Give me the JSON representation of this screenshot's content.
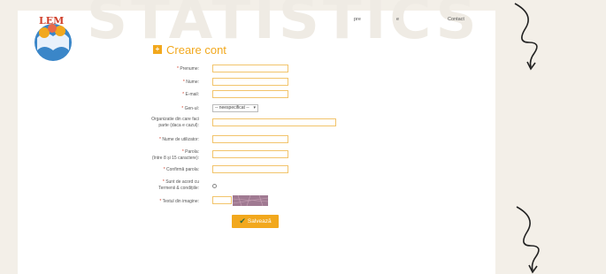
{
  "watermark": {
    "text": "STATISTICS"
  },
  "nav": {
    "items": [
      "pre",
      "e",
      "Contact"
    ]
  },
  "logo": {
    "text": "LEM"
  },
  "form": {
    "title": "Creare cont",
    "fields": {
      "first_name": {
        "label": "Prenume:",
        "value": ""
      },
      "last_name": {
        "label": "Nume:",
        "value": ""
      },
      "email": {
        "label": "E-mail:",
        "value": ""
      },
      "gender": {
        "label": "Gen-ul:",
        "selected": "-- neespecificat --"
      },
      "organization": {
        "label_line1": "Organizatie din care faci",
        "label_line2": "parte (daca e cazul):",
        "value": ""
      },
      "username": {
        "label": "Nume de utilizator:",
        "value": ""
      },
      "password": {
        "label_line1": "Parola:",
        "label_line2": "(între 8 și 15 caractere):",
        "value": ""
      },
      "confirm_password": {
        "label": "Confirmă parola:",
        "value": ""
      },
      "terms": {
        "label_line1": "Sunt de acord cu",
        "label_line2": "Termenii & condițiile:"
      },
      "captcha": {
        "label": "Textul din imagine:",
        "value": ""
      }
    },
    "required_marker": "*",
    "save_label": "Salvează"
  },
  "colors": {
    "accent": "#f2a81d",
    "background": "#f3efe8",
    "required": "#d0402b"
  },
  "icons": {
    "title": "plus-square-icon",
    "save": "checkmark-icon",
    "decor": "squiggle-arrow-icon"
  }
}
